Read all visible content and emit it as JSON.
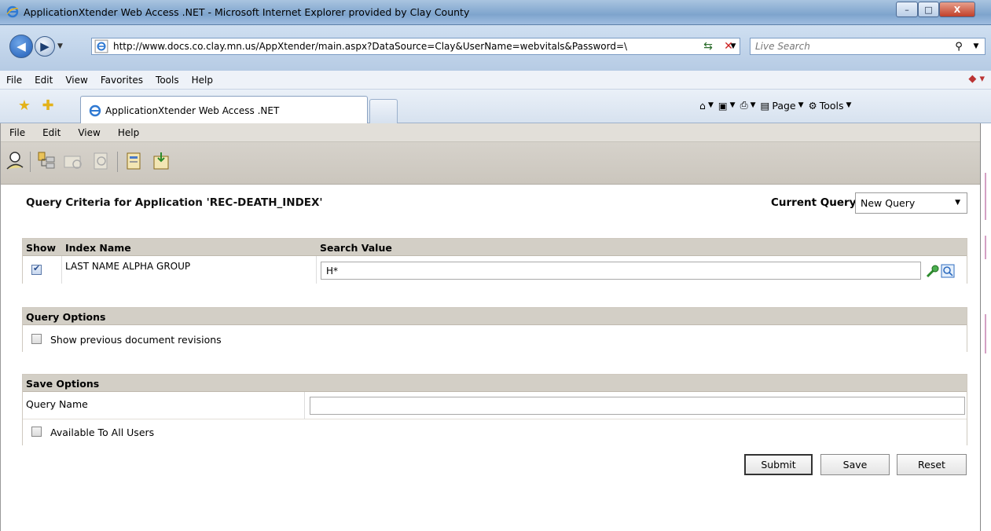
{
  "window": {
    "title": "ApplicationXtender Web Access .NET - Microsoft Internet Explorer provided by Clay County",
    "controls": {
      "minimize": "–",
      "maximize": "□",
      "close": "X"
    }
  },
  "browser": {
    "url": "http://www.docs.co.clay.mn.us/AppXtender/main.aspx?DataSource=Clay&UserName=webvitals&Password=\\",
    "search_placeholder": "Live Search",
    "menu": [
      "File",
      "Edit",
      "View",
      "Favorites",
      "Tools",
      "Help"
    ],
    "tab_title": "ApplicationXtender Web Access .NET",
    "commands": {
      "page": "Page",
      "tools": "Tools"
    }
  },
  "app": {
    "menu": [
      "File",
      "Edit",
      "View",
      "Help"
    ],
    "toolbar_icons": [
      "login-key-icon",
      "tree-icon",
      "folder-search-icon",
      "doc-search-icon",
      "new-doc-icon",
      "import-doc-icon"
    ]
  },
  "query": {
    "title": "Query Criteria for Application 'REC-DEATH_INDEX'",
    "current_query_label": "Current Query:",
    "current_query_value": "New Query",
    "columns": {
      "show": "Show",
      "index_name": "Index Name",
      "search_value": "Search Value"
    },
    "rows": [
      {
        "show": true,
        "index_name": "LAST NAME ALPHA GROUP",
        "search_value": "H*"
      }
    ]
  },
  "query_options": {
    "header": "Query Options",
    "show_prev_label": "Show previous document revisions",
    "show_prev_checked": false
  },
  "save_options": {
    "header": "Save Options",
    "query_name_label": "Query Name",
    "query_name_value": "",
    "all_users_label": "Available To All Users",
    "all_users_checked": false
  },
  "buttons": {
    "submit": "Submit",
    "save": "Save",
    "reset": "Reset"
  },
  "colors": {
    "section_header": "#d3cfc6",
    "app_chrome": "#e2dfd9",
    "ie_chrome": "#b6cbe4"
  }
}
